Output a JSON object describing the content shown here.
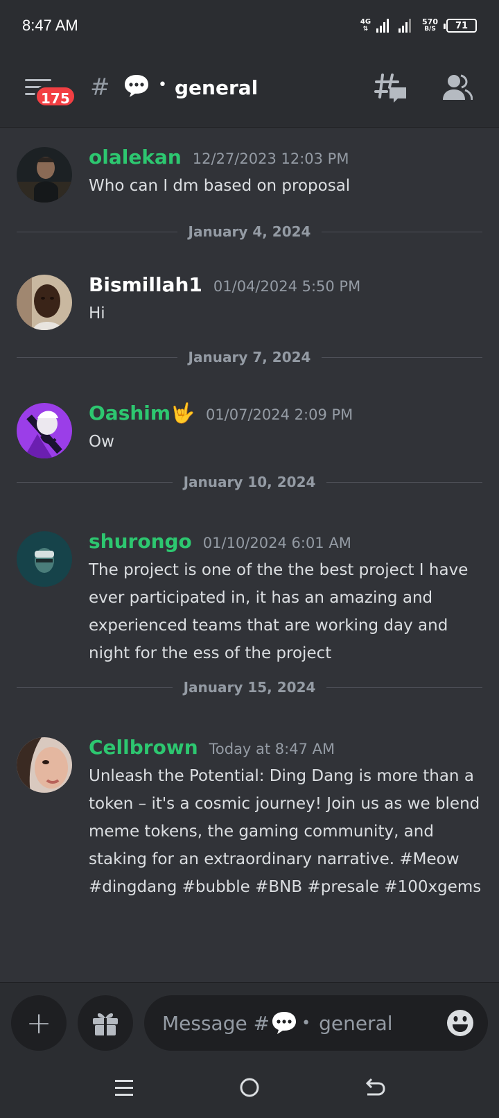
{
  "status_bar": {
    "time": "8:47 AM",
    "network_type": "4G",
    "data_speed_value": "570",
    "data_speed_unit": "B/S",
    "battery_level": "71"
  },
  "header": {
    "unread_badge": "175",
    "hash_symbol": "#",
    "channel_separator": "•",
    "channel_name": "general"
  },
  "messages": [
    {
      "username": "olalekan",
      "timestamp": "12/27/2023 12:03 PM",
      "text": "Who can I dm based on proposal",
      "name_color": "#2dc770"
    },
    {
      "username": "Bismillah1",
      "timestamp": "01/04/2024 5:50 PM",
      "text": "Hi",
      "name_color": "#ffffff"
    },
    {
      "username": "Oashim🤟",
      "timestamp": "01/07/2024 2:09 PM",
      "text": "Ow",
      "name_color": "#2dc770"
    },
    {
      "username": "shurongo",
      "timestamp": "01/10/2024 6:01 AM",
      "text": "The project is one of the the best project I have ever participated in, it has an amazing and experienced teams that are working day and night for the ess of the project",
      "name_color": "#2dc770"
    },
    {
      "username": "Cellbrown",
      "timestamp": "Today at 8:47 AM",
      "text": "Unleash the Potential: Ding Dang is more than a token – it's a cosmic journey! Join us as we blend meme tokens, the gaming community, and staking for an extraordinary narrative. #Meow #dingdang #bubble #BNB  #presale #100xgems",
      "name_color": "#2dc770"
    }
  ],
  "date_dividers": [
    "January 4, 2024",
    "January 7, 2024",
    "January 10, 2024",
    "January 15, 2024"
  ],
  "composer": {
    "placeholder_prefix": "Message #",
    "placeholder_separator": "•",
    "placeholder_channel": "general",
    "add_symbol": "+"
  },
  "icons": {
    "menu": "hamburger-menu-icon",
    "channel_emoji": "speech-bubble-icon",
    "threads": "threads-icon",
    "members": "members-icon",
    "gift": "gift-icon",
    "emoji": "smiley-icon",
    "nav_recents": "recents-icon",
    "nav_home": "home-icon",
    "nav_back": "back-icon"
  },
  "colors": {
    "background": "#313338",
    "header_background": "#2b2d31",
    "username_green": "#2dc770",
    "badge_red": "#f23f43",
    "muted_text": "#949ba4"
  }
}
